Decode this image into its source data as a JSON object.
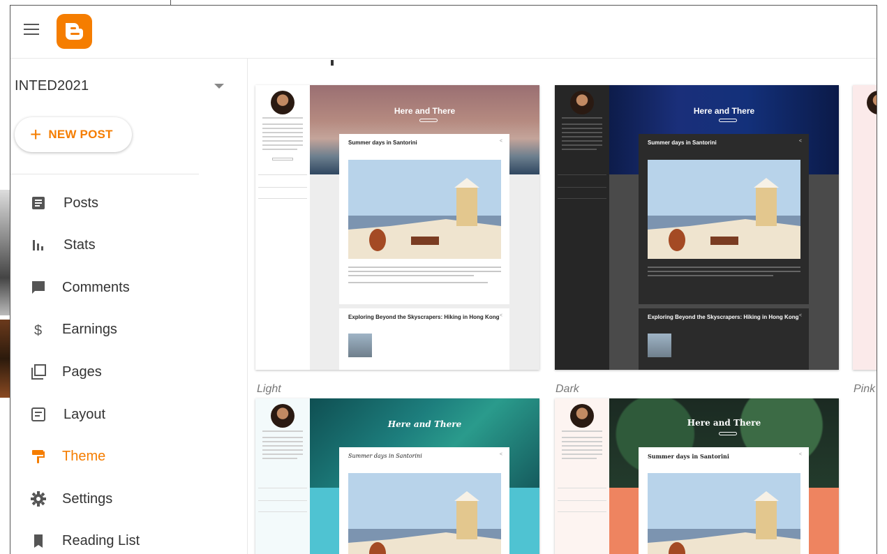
{
  "sidebar": {
    "blog_name": "INTED2021",
    "new_post_label": "NEW POST",
    "items": [
      {
        "label": "Posts",
        "icon": "posts-icon"
      },
      {
        "label": "Stats",
        "icon": "stats-icon"
      },
      {
        "label": "Comments",
        "icon": "comments-icon"
      },
      {
        "label": "Earnings",
        "icon": "earnings-icon"
      },
      {
        "label": "Pages",
        "icon": "pages-icon"
      },
      {
        "label": "Layout",
        "icon": "layout-icon"
      },
      {
        "label": "Theme",
        "icon": "theme-icon",
        "active": true
      },
      {
        "label": "Settings",
        "icon": "settings-icon"
      },
      {
        "label": "Reading List",
        "icon": "reading-list-icon"
      }
    ]
  },
  "themes": [
    {
      "caption": "Light",
      "blog_title": "Here and There",
      "post1": "Summer days in Santorini",
      "post2": "Exploring Beyond the Skyscrapers: Hiking in Hong Kong"
    },
    {
      "caption": "Dark",
      "blog_title": "Here and There",
      "post1": "Summer days in Santorini",
      "post2": "Exploring Beyond the Skyscrapers: Hiking in Hong Kong"
    },
    {
      "caption": "Pink"
    },
    {
      "blog_title": "Here and There",
      "post1": "Summer days in Santorini"
    },
    {
      "blog_title": "Here and There",
      "post1": "Summer days in Santorini"
    }
  ],
  "colors": {
    "accent": "#f57d00",
    "text": "#333333",
    "icon": "#555555"
  }
}
